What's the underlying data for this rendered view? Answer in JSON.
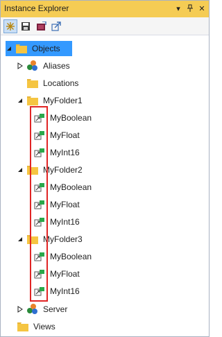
{
  "window": {
    "title": "Instance Explorer",
    "dropdown_glyph": "▾",
    "pin_glyph": "⊥",
    "close_glyph": "✕"
  },
  "toolbar": {
    "buttons": [
      {
        "name": "sync-icon",
        "glyph": "✳"
      },
      {
        "name": "save-icon",
        "glyph": "💾"
      },
      {
        "name": "import-icon",
        "glyph": "⚑"
      },
      {
        "name": "export-icon",
        "glyph": "↗"
      }
    ]
  },
  "tree": {
    "root": "Objects",
    "aliases": "Aliases",
    "locations": "Locations",
    "folders": [
      {
        "label": "MyFolder1",
        "children": [
          "MyBoolean",
          "MyFloat",
          "MyInt16"
        ]
      },
      {
        "label": "MyFolder2",
        "children": [
          "MyBoolean",
          "MyFloat",
          "MyInt16"
        ]
      },
      {
        "label": "MyFolder3",
        "children": [
          "MyBoolean",
          "MyFloat",
          "MyInt16"
        ]
      }
    ],
    "server": "Server",
    "views": "Views"
  },
  "colors": {
    "titlebar": "#f5cc54",
    "selection": "#3399ff",
    "folder": "#f5c542",
    "highlight": "#e02424"
  }
}
